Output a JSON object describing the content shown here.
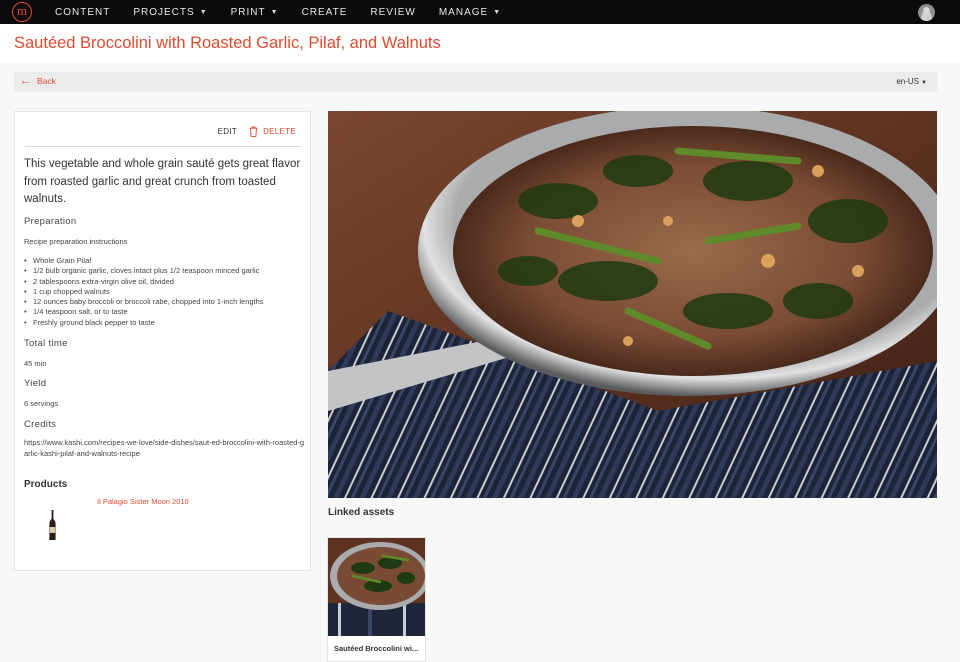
{
  "nav": {
    "logo_letter": "m",
    "items": [
      {
        "label": "CONTENT",
        "dropdown": false
      },
      {
        "label": "PROJECTS",
        "dropdown": true
      },
      {
        "label": "PRINT",
        "dropdown": true
      },
      {
        "label": "CREATE",
        "dropdown": false
      },
      {
        "label": "REVIEW",
        "dropdown": false
      },
      {
        "label": "MANAGE",
        "dropdown": true
      }
    ]
  },
  "page": {
    "title": "Sautéed Broccolini with Roasted Garlic, Pilaf, and Walnuts",
    "back_label": "Back",
    "locale": "en-US"
  },
  "recipe": {
    "edit_label": "EDIT",
    "delete_label": "DELETE",
    "description": "This vegetable and whole grain sauté gets great flavor from roasted garlic and great crunch from toasted walnuts.",
    "preparation_heading": "Preparation",
    "preparation_text": "Recipe preparation instructions",
    "ingredients": [
      "Whole Grain Pilaf",
      "1/2 bulb organic garlic, cloves intact plus 1/2 teaspoon minced garlic",
      "2 tablespoons extra-virgin olive oil, divided",
      "1 cup chopped walnuts",
      "12 ounces baby broccoli or broccoli rabe, chopped into 1-inch lengths",
      "1/4 teaspoon salt, or to taste",
      "Freshly ground black pepper to taste"
    ],
    "total_time_heading": "Total time",
    "total_time": "45 min",
    "yield_heading": "Yield",
    "yield": "6 servings",
    "credits_heading": "Credits",
    "credits": "https://www.kashi.com/recipes-we-love/side-dishes/saut-ed-broccolini-with-roasted-garlic-kashi-pilaf-and-walnuts-recipe",
    "products_heading": "Products",
    "product_name": "Il Palagio Sister Moon 2010"
  },
  "assets": {
    "heading": "Linked assets",
    "items": [
      {
        "label": "Sautéed Broccolini wi..."
      }
    ]
  },
  "colors": {
    "accent": "#e24a2e",
    "nav_bg": "#0b0b0b",
    "page_bg": "#f8f8f8"
  }
}
